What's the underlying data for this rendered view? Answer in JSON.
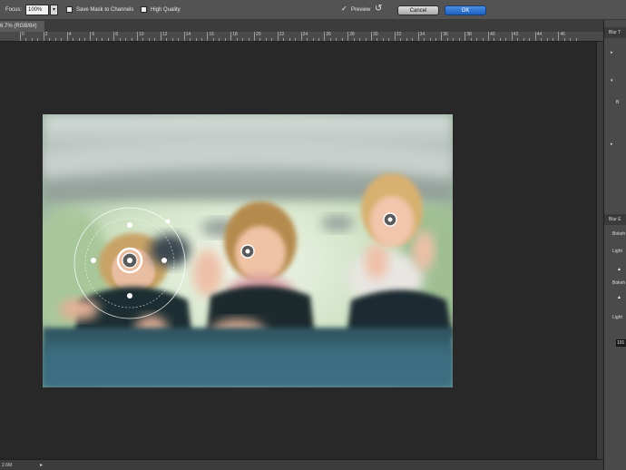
{
  "options_bar": {
    "focus_label": "Focus:",
    "focus_value": "100%",
    "focus_arrow": "▾",
    "save_mask_label": "Save Mask to Channels",
    "high_quality_label": "High Quality",
    "preview_check": "✓",
    "preview_label": "Preview",
    "reset_icon": "↺",
    "cancel_label": "Cancel",
    "ok_label": "OK"
  },
  "doc_tab": {
    "title": "6.7% (RGB/8#)"
  },
  "ruler": {
    "labels": [
      "0",
      "2",
      "4",
      "6",
      "8",
      "10",
      "12",
      "14",
      "16",
      "18",
      "20",
      "22",
      "24",
      "26",
      "28",
      "30",
      "32",
      "34",
      "36",
      "38",
      "40",
      "42",
      "44",
      "46"
    ]
  },
  "panel": {
    "head1": "Blur T",
    "tri_a": "▸",
    "tri_b": "▾",
    "tri_c": "▸",
    "label_b": "B",
    "head2": "Blur E",
    "label_bokeh": "Bokeh",
    "label_light1": "Light",
    "label_bokeh2": "Bokeh",
    "label_light2": "Light",
    "slider_tri": "▲",
    "field_value": "191"
  },
  "status_bar": {
    "text": "2.6M",
    "arrow": "▸"
  },
  "colors": {
    "accent": "#2a6fd1",
    "canvas_bg": "#282828",
    "panel_bg": "#4a4a4a"
  },
  "icons": {
    "reset": "reset-icon",
    "preview": "check-icon",
    "ok": "ok-button"
  }
}
